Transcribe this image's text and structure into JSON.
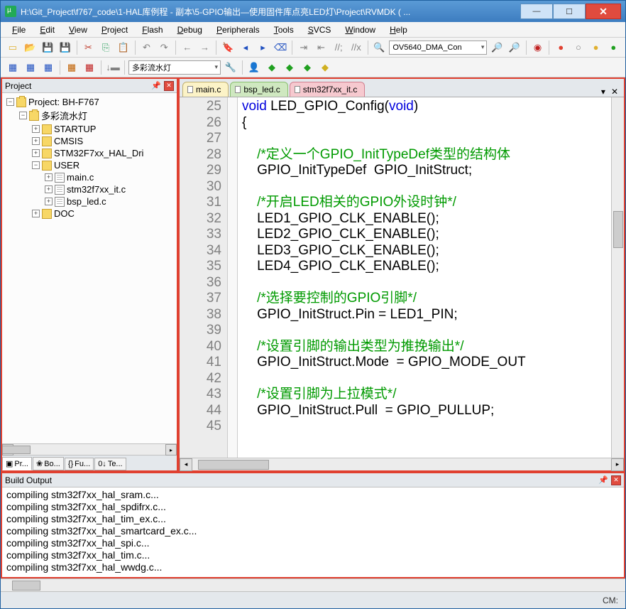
{
  "title": "H:\\Git_Project\\f767_code\\1-HAL库例程 - 副本\\5-GPIO输出—使用固件库点亮LED灯\\Project\\RVMDK ( ...",
  "menu": [
    "File",
    "Edit",
    "View",
    "Project",
    "Flash",
    "Debug",
    "Peripherals",
    "Tools",
    "SVCS",
    "Window",
    "Help"
  ],
  "toolbar1_combo": "OV5640_DMA_Con",
  "toolbar2_combo": "多彩流水灯",
  "project": {
    "header": "Project",
    "root": "Project: BH-F767",
    "tree": [
      {
        "lvl": 0,
        "box": "m",
        "icon": "fbag",
        "label": "Project: BH-F767"
      },
      {
        "lvl": 1,
        "box": "m",
        "icon": "fbag",
        "label": "多彩流水灯"
      },
      {
        "lvl": 2,
        "box": "p",
        "icon": "fdir",
        "label": "STARTUP"
      },
      {
        "lvl": 2,
        "box": "p",
        "icon": "fdir",
        "label": "CMSIS"
      },
      {
        "lvl": 2,
        "box": "p",
        "icon": "fdir",
        "label": "STM32F7xx_HAL_Dri"
      },
      {
        "lvl": 2,
        "box": "m",
        "icon": "fdir",
        "label": "USER"
      },
      {
        "lvl": 3,
        "box": "p",
        "icon": "ffile",
        "label": "main.c"
      },
      {
        "lvl": 3,
        "box": "p",
        "icon": "ffile",
        "label": "stm32f7xx_it.c"
      },
      {
        "lvl": 3,
        "box": "p",
        "icon": "ffile",
        "label": "bsp_led.c"
      },
      {
        "lvl": 2,
        "box": "p",
        "icon": "fdir",
        "label": "DOC"
      }
    ],
    "bottom_tabs": [
      {
        "icon": "▣",
        "label": "Pr...",
        "active": true
      },
      {
        "icon": "❀",
        "label": "Bo..."
      },
      {
        "icon": "{}",
        "label": "Fu..."
      },
      {
        "icon": "0↓",
        "label": "Te..."
      }
    ]
  },
  "editor": {
    "tabs": [
      {
        "name": "main.c",
        "state": ""
      },
      {
        "name": "bsp_led.c",
        "state": "act"
      },
      {
        "name": "stm32f7xx_it.c",
        "state": "inact"
      }
    ],
    "lines": [
      {
        "n": 25,
        "html": "<span class='kw'>void</span> LED_GPIO_Config(<span class='kw'>void</span>)"
      },
      {
        "n": 26,
        "html": "{"
      },
      {
        "n": 27,
        "html": ""
      },
      {
        "n": 28,
        "html": "    <span class='cm'>/*定义一个GPIO_InitTypeDef类型的结构体</span>"
      },
      {
        "n": 29,
        "html": "    GPIO_InitTypeDef  GPIO_InitStruct;"
      },
      {
        "n": 30,
        "html": ""
      },
      {
        "n": 31,
        "html": "    <span class='cm'>/*开启LED相关的GPIO外设时钟*/</span>"
      },
      {
        "n": 32,
        "html": "    LED1_GPIO_CLK_ENABLE();"
      },
      {
        "n": 33,
        "html": "    LED2_GPIO_CLK_ENABLE();"
      },
      {
        "n": 34,
        "html": "    LED3_GPIO_CLK_ENABLE();"
      },
      {
        "n": 35,
        "html": "    LED4_GPIO_CLK_ENABLE();"
      },
      {
        "n": 36,
        "html": ""
      },
      {
        "n": 37,
        "html": "    <span class='cm'>/*选择要控制的GPIO引脚*/</span>"
      },
      {
        "n": 38,
        "html": "    GPIO_InitStruct.Pin = LED1_PIN;"
      },
      {
        "n": 39,
        "html": ""
      },
      {
        "n": 40,
        "html": "    <span class='cm'>/*设置引脚的输出类型为推挽输出*/</span>"
      },
      {
        "n": 41,
        "html": "    GPIO_InitStruct.Mode  = GPIO_MODE_OUT"
      },
      {
        "n": 42,
        "html": ""
      },
      {
        "n": 43,
        "html": "    <span class='cm'>/*设置引脚为上拉模式*/</span>"
      },
      {
        "n": 44,
        "html": "    GPIO_InitStruct.Pull  = GPIO_PULLUP;"
      },
      {
        "n": 45,
        "html": ""
      }
    ]
  },
  "build": {
    "header": "Build Output",
    "lines": [
      "compiling stm32f7xx_hal_sram.c...",
      "compiling stm32f7xx_hal_spdifrx.c...",
      "compiling stm32f7xx_hal_tim_ex.c...",
      "compiling stm32f7xx_hal_smartcard_ex.c...",
      "compiling stm32f7xx_hal_spi.c...",
      "compiling stm32f7xx_hal_tim.c...",
      "compiling stm32f7xx_hal_wwdg.c..."
    ]
  },
  "status": "CM:"
}
